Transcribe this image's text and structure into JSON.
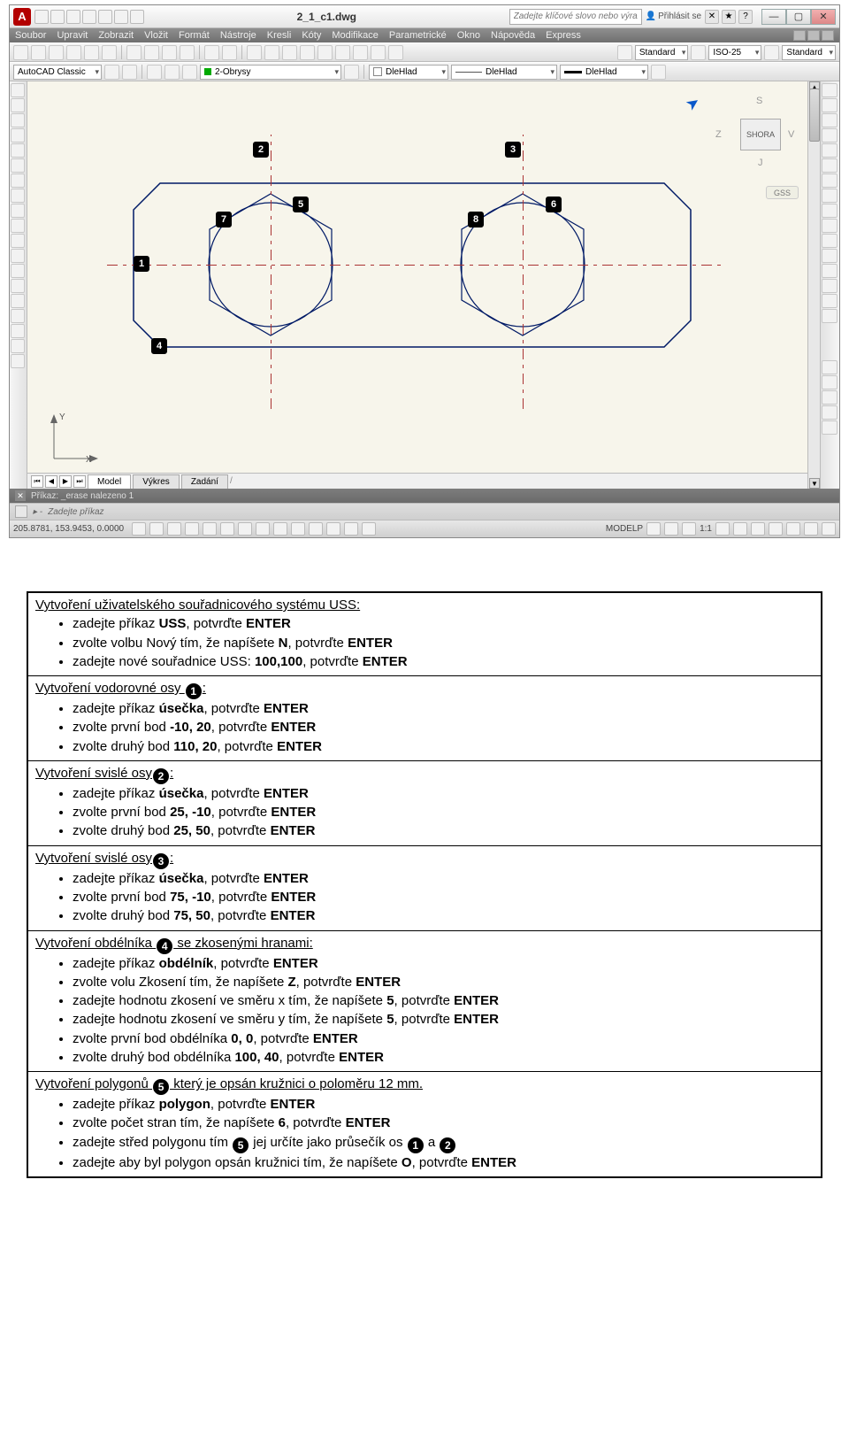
{
  "window": {
    "title": "2_1_c1.dwg",
    "search_placeholder": "Zadejte klíčové slovo nebo výraz.",
    "signin": "Přihlásit se"
  },
  "menubar": [
    "Soubor",
    "Upravit",
    "Zobrazit",
    "Vložit",
    "Formát",
    "Nástroje",
    "Kresli",
    "Kóty",
    "Modifikace",
    "Parametrické",
    "Okno",
    "Nápověda",
    "Express"
  ],
  "toolbars": {
    "style1": "Standard",
    "style2": "ISO-25",
    "style3": "Standard",
    "workspace": "AutoCAD Classic",
    "layer": "2-Obrysy",
    "lt1": "DleHlad",
    "lt2": "DleHlad",
    "lt3": "DleHlad"
  },
  "viewcube": {
    "face": "SHORA",
    "s": "S",
    "j": "J",
    "z": "Z",
    "v": "V",
    "gss": "GSS"
  },
  "tabs": {
    "t1": "Model",
    "t2": "Výkres",
    "t3": "Zadání"
  },
  "cmd": {
    "history": "Příkaz: _erase nalezeno 1",
    "prompt": "Zadejte příkaz"
  },
  "status": {
    "coords": "205.8781, 153.9453, 0.0000",
    "model": "MODELP",
    "scale": "1:1"
  },
  "ucs": {
    "y": "Y",
    "x": "X"
  },
  "markers": {
    "m1": "1",
    "m2": "2",
    "m3": "3",
    "m4": "4",
    "m5": "5",
    "m6": "6",
    "m7": "7",
    "m8": "8"
  },
  "instr": {
    "s1": {
      "title": "Vytvoření uživatelského souřadnicového systému USS:",
      "b": [
        {
          "pre": "zadejte příkaz ",
          "bold": "USS",
          "post": ", potvrďte ",
          "bold2": "ENTER"
        },
        {
          "pre": "zvolte volbu Nový tím, že napíšete ",
          "bold": "N",
          "post": ", potvrďte ",
          "bold2": "ENTER"
        },
        {
          "pre": "zadejte nové souřadnice USS: ",
          "bold": "100,100",
          "post": ", potvrďte ",
          "bold2": "ENTER"
        }
      ]
    },
    "s2": {
      "title_pre": "Vytvoření vodorovné osy ",
      "badge": "1",
      "title_post": ":",
      "b": [
        {
          "pre": "zadejte příkaz ",
          "bold": "úsečka",
          "post": ", potvrďte ",
          "bold2": "ENTER"
        },
        {
          "pre": "zvolte první bod ",
          "bold": "-10, 20",
          "post": ", potvrďte ",
          "bold2": "ENTER"
        },
        {
          "pre": "zvolte druhý bod ",
          "bold": "110, 20",
          "post": ", potvrďte ",
          "bold2": "ENTER"
        }
      ]
    },
    "s3": {
      "title_pre": "Vytvoření svislé osy",
      "badge": "2",
      "title_post": ":",
      "b": [
        {
          "pre": "zadejte příkaz ",
          "bold": "úsečka",
          "post": ", potvrďte ",
          "bold2": "ENTER"
        },
        {
          "pre": "zvolte první bod ",
          "bold": "25, -10",
          "post": ", potvrďte ",
          "bold2": "ENTER"
        },
        {
          "pre": "zvolte druhý bod ",
          "bold": "25, 50",
          "post": ", potvrďte ",
          "bold2": "ENTER"
        }
      ]
    },
    "s4": {
      "title_pre": "Vytvoření svislé osy",
      "badge": "3",
      "title_post": ":",
      "b": [
        {
          "pre": "zadejte příkaz ",
          "bold": "úsečka",
          "post": ", potvrďte ",
          "bold2": "ENTER"
        },
        {
          "pre": "zvolte první bod ",
          "bold": "75, -10",
          "post": ", potvrďte ",
          "bold2": "ENTER"
        },
        {
          "pre": "zvolte druhý bod ",
          "bold": "75, 50",
          "post": ", potvrďte ",
          "bold2": "ENTER"
        }
      ]
    },
    "s5": {
      "title_pre": "Vytvoření obdélníka ",
      "badge": "4",
      "title_post": " se zkosenými hranami:",
      "b": [
        {
          "pre": "zadejte příkaz ",
          "bold": "obdélník",
          "post": ", potvrďte ",
          "bold2": "ENTER"
        },
        {
          "pre": "zvolte volu Zkosení tím, že napíšete ",
          "bold": "Z",
          "post": ", potvrďte ",
          "bold2": "ENTER"
        },
        {
          "pre": "zadejte hodnotu zkosení ve směru x tím, že napíšete ",
          "bold": "5",
          "post": ", potvrďte ",
          "bold2": "ENTER"
        },
        {
          "pre": "zadejte hodnotu zkosení ve směru y tím, že napíšete ",
          "bold": "5",
          "post": ", potvrďte ",
          "bold2": "ENTER"
        },
        {
          "pre": "zvolte první bod obdélníka ",
          "bold": "0, 0",
          "post": ", potvrďte ",
          "bold2": "ENTER"
        },
        {
          "pre": "zvolte druhý bod obdélníka ",
          "bold": "100, 40",
          "post": ", potvrďte ",
          "bold2": "ENTER"
        }
      ]
    },
    "s6": {
      "title_pre": "Vytvoření polygonů ",
      "badge": "5",
      "title_post": " který je opsán kružnici o poloměru 12 mm.",
      "b": [
        {
          "pre": "zadejte příkaz ",
          "bold": "polygon",
          "post": ", potvrďte ",
          "bold2": "ENTER"
        },
        {
          "pre": "zvolte počet stran tím, že napíšete ",
          "bold": "6",
          "post": ", potvrďte ",
          "bold2": "ENTER"
        }
      ],
      "special1_pre": "zadejte střed polygonu tím ",
      "special1_b1": "5",
      "special1_mid": " jej určíte jako průsečík os ",
      "special1_b2": "1",
      "special1_and": " a ",
      "special1_b3": "2",
      "special2_pre": "zadejte aby byl polygon opsán kružnici tím, že napíšete ",
      "special2_bold": "O",
      "special2_post": ", potvrďte ",
      "special2_bold2": "ENTER"
    }
  }
}
